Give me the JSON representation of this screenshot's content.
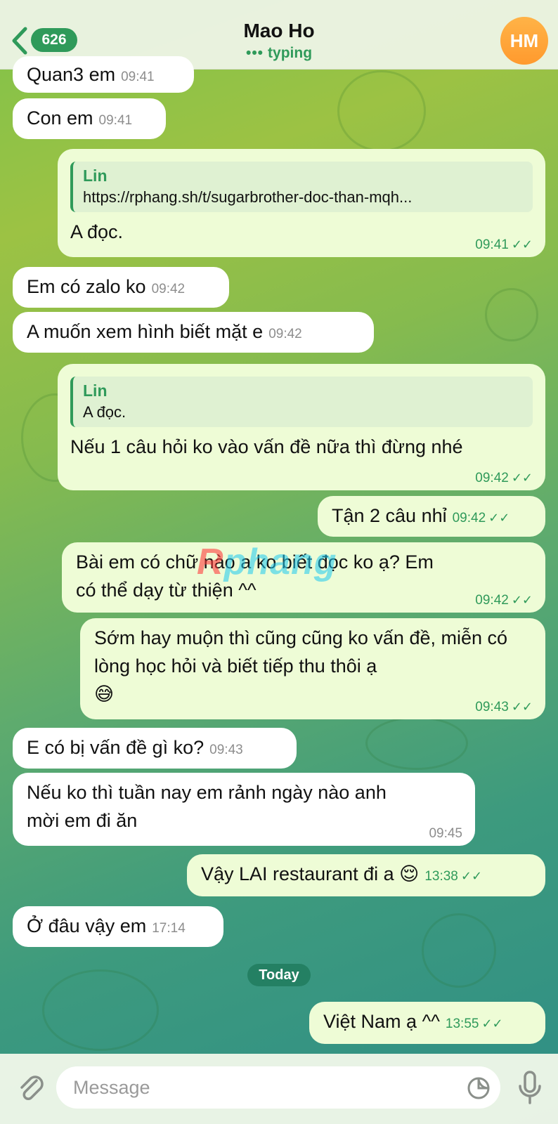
{
  "header": {
    "back_count": "626",
    "title": "Mao Ho",
    "status_dots": "•••",
    "status": "typing",
    "avatar_initials": "HM"
  },
  "messages": [
    {
      "text": "Quan3 em",
      "time": "09:41"
    },
    {
      "text": "Con em",
      "time": "09:41"
    },
    {
      "reply_name": "Lin",
      "reply_text": "https://rphang.sh/t/sugarbrother-doc-than-mqh...",
      "text": "A đọc.",
      "time": "09:41",
      "tick": "✓✓"
    },
    {
      "text": "Em có zalo ko",
      "time": "09:42"
    },
    {
      "text": "A muốn xem hình biết mặt e",
      "time": "09:42"
    },
    {
      "reply_name": "Lin",
      "reply_text": "A đọc.",
      "text": "Nếu 1 câu hỏi ko vào vấn đề nữa thì đừng nhé",
      "time": "09:42",
      "tick": "✓✓"
    },
    {
      "text": "Tận 2 câu nhỉ",
      "time": "09:42",
      "tick": "✓✓"
    },
    {
      "text": "Bài em có chữ nào a ko biết đọc ko ạ? Em có thể dạy từ thiện ^^",
      "time": "09:42",
      "tick": "✓✓"
    },
    {
      "text": "Sớm hay muộn thì cũng cũng ko vấn đề, miễn có lòng học hỏi và biết tiếp thu thôi ạ",
      "emoji": "😅",
      "time": "09:43",
      "tick": "✓✓"
    },
    {
      "text": "E có bị vấn đề gì ko?",
      "time": "09:43"
    },
    {
      "text": "Nếu ko thì tuần nay em rảnh ngày nào anh mời em đi ăn",
      "time": "09:45"
    },
    {
      "text": "Vậy LAI restaurant đi a",
      "emoji": "😌",
      "time": "13:38",
      "tick": "✓✓"
    },
    {
      "text": "Ở đâu vậy em",
      "time": "17:14"
    },
    {
      "text": "Việt Nam ạ ^^",
      "time": "13:55",
      "tick": "✓✓"
    }
  ],
  "day_separator": "Today",
  "watermark": {
    "part1": "R",
    "part2": "phang"
  },
  "composer": {
    "placeholder": "Message"
  },
  "colors": {
    "accent": "#2f9a5a",
    "outgoing_bubble": "#eefcd6",
    "incoming_bubble": "#ffffff",
    "avatar": "#ff9a2e"
  }
}
